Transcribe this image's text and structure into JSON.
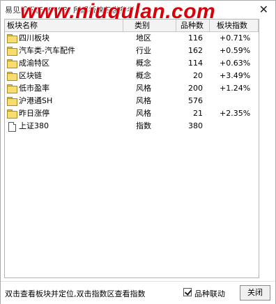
{
  "window": {
    "title": "易见股份(600093)    所属板块仅供参考",
    "watermark": "www.niugulan.com",
    "close_glyph": "✕"
  },
  "table": {
    "headers": {
      "name": "板块名称",
      "type": "类别",
      "count": "品种数",
      "index": "板块指数"
    },
    "rows": [
      {
        "icon": "folder",
        "name": "四川板块",
        "type": "地区",
        "count": "116",
        "index": "+0.71%"
      },
      {
        "icon": "folder",
        "name": "汽车类-汽车配件",
        "type": "行业",
        "count": "162",
        "index": "+0.59%"
      },
      {
        "icon": "folder",
        "name": "成渝特区",
        "type": "概念",
        "count": "114",
        "index": "+0.63%"
      },
      {
        "icon": "folder",
        "name": "区块链",
        "type": "概念",
        "count": "20",
        "index": "+3.49%"
      },
      {
        "icon": "folder",
        "name": "低市盈率",
        "type": "风格",
        "count": "200",
        "index": "+1.24%"
      },
      {
        "icon": "folder",
        "name": "沪港通SH",
        "type": "风格",
        "count": "576",
        "index": ""
      },
      {
        "icon": "folder",
        "name": "昨日涨停",
        "type": "风格",
        "count": "21",
        "index": "+2.35%"
      },
      {
        "icon": "document",
        "name": "上证380",
        "type": "指数",
        "count": "380",
        "index": ""
      }
    ]
  },
  "footer": {
    "hint": "双击查看板块并定位,双击指数区查看指数",
    "sync_label": "品种联动",
    "sync_checked": true,
    "close_label": "关闭"
  }
}
